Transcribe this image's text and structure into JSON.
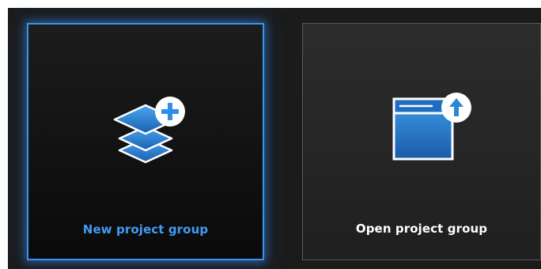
{
  "cards": [
    {
      "label": "New project group",
      "icon": "layers-plus-icon",
      "state": "selected",
      "accent_color": "#3a93ea"
    },
    {
      "label": "Open project group",
      "icon": "window-upload-icon",
      "state": "normal",
      "accent_color": "#2f86d4"
    }
  ]
}
